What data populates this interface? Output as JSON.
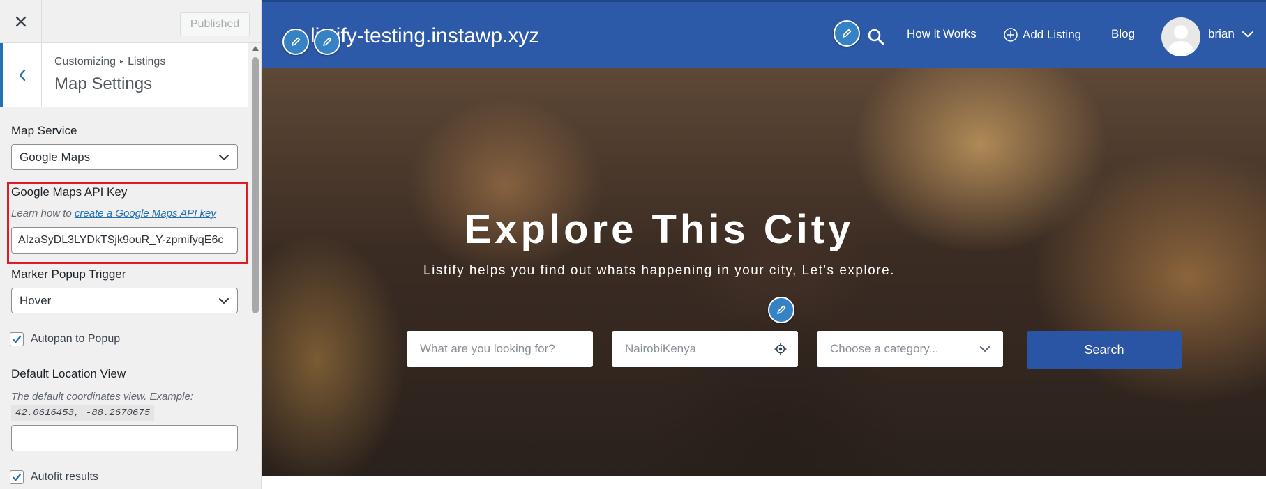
{
  "customizer": {
    "close_icon": "close-icon",
    "publish_button": "Published",
    "breadcrumb": {
      "parent": "Customizing",
      "separator": "▸",
      "section": "Listings"
    },
    "section_title": "Map Settings",
    "map_service": {
      "label": "Map Service",
      "value": "Google Maps"
    },
    "api_key": {
      "label": "Google Maps API Key",
      "description_prefix": "Learn how to ",
      "description_link": "create a Google Maps API key",
      "value": "AIzaSyDL3LYDkTSjk9ouR_Y-zpmifyqE6c"
    },
    "marker_popup": {
      "label": "Marker Popup Trigger",
      "value": "Hover"
    },
    "autopan": {
      "label": "Autopan to Popup",
      "checked": true
    },
    "default_location": {
      "label": "Default Location View",
      "description": "The default coordinates view. Example:",
      "example": "42.0616453, -88.2670675",
      "value": ""
    },
    "autofit": {
      "label": "Autofit results",
      "checked": true
    },
    "highlight_color": "#e21b23",
    "accent_color": "#2271b1"
  },
  "site": {
    "title": "listify-testing.instawp.xyz",
    "nav": {
      "how_it_works": "How it Works",
      "add_listing": "Add Listing",
      "blog": "Blog",
      "user": "brian"
    },
    "hero": {
      "title": "Explore This City",
      "subtitle": "Listify helps you find out whats happening in your city, Let's explore.",
      "keyword_placeholder": "What are you looking for?",
      "location_value": "NairobiKenya",
      "category_placeholder": "Choose a category...",
      "search_button": "Search"
    },
    "header_color": "#2d5aa8",
    "button_color": "#2a55a5"
  }
}
